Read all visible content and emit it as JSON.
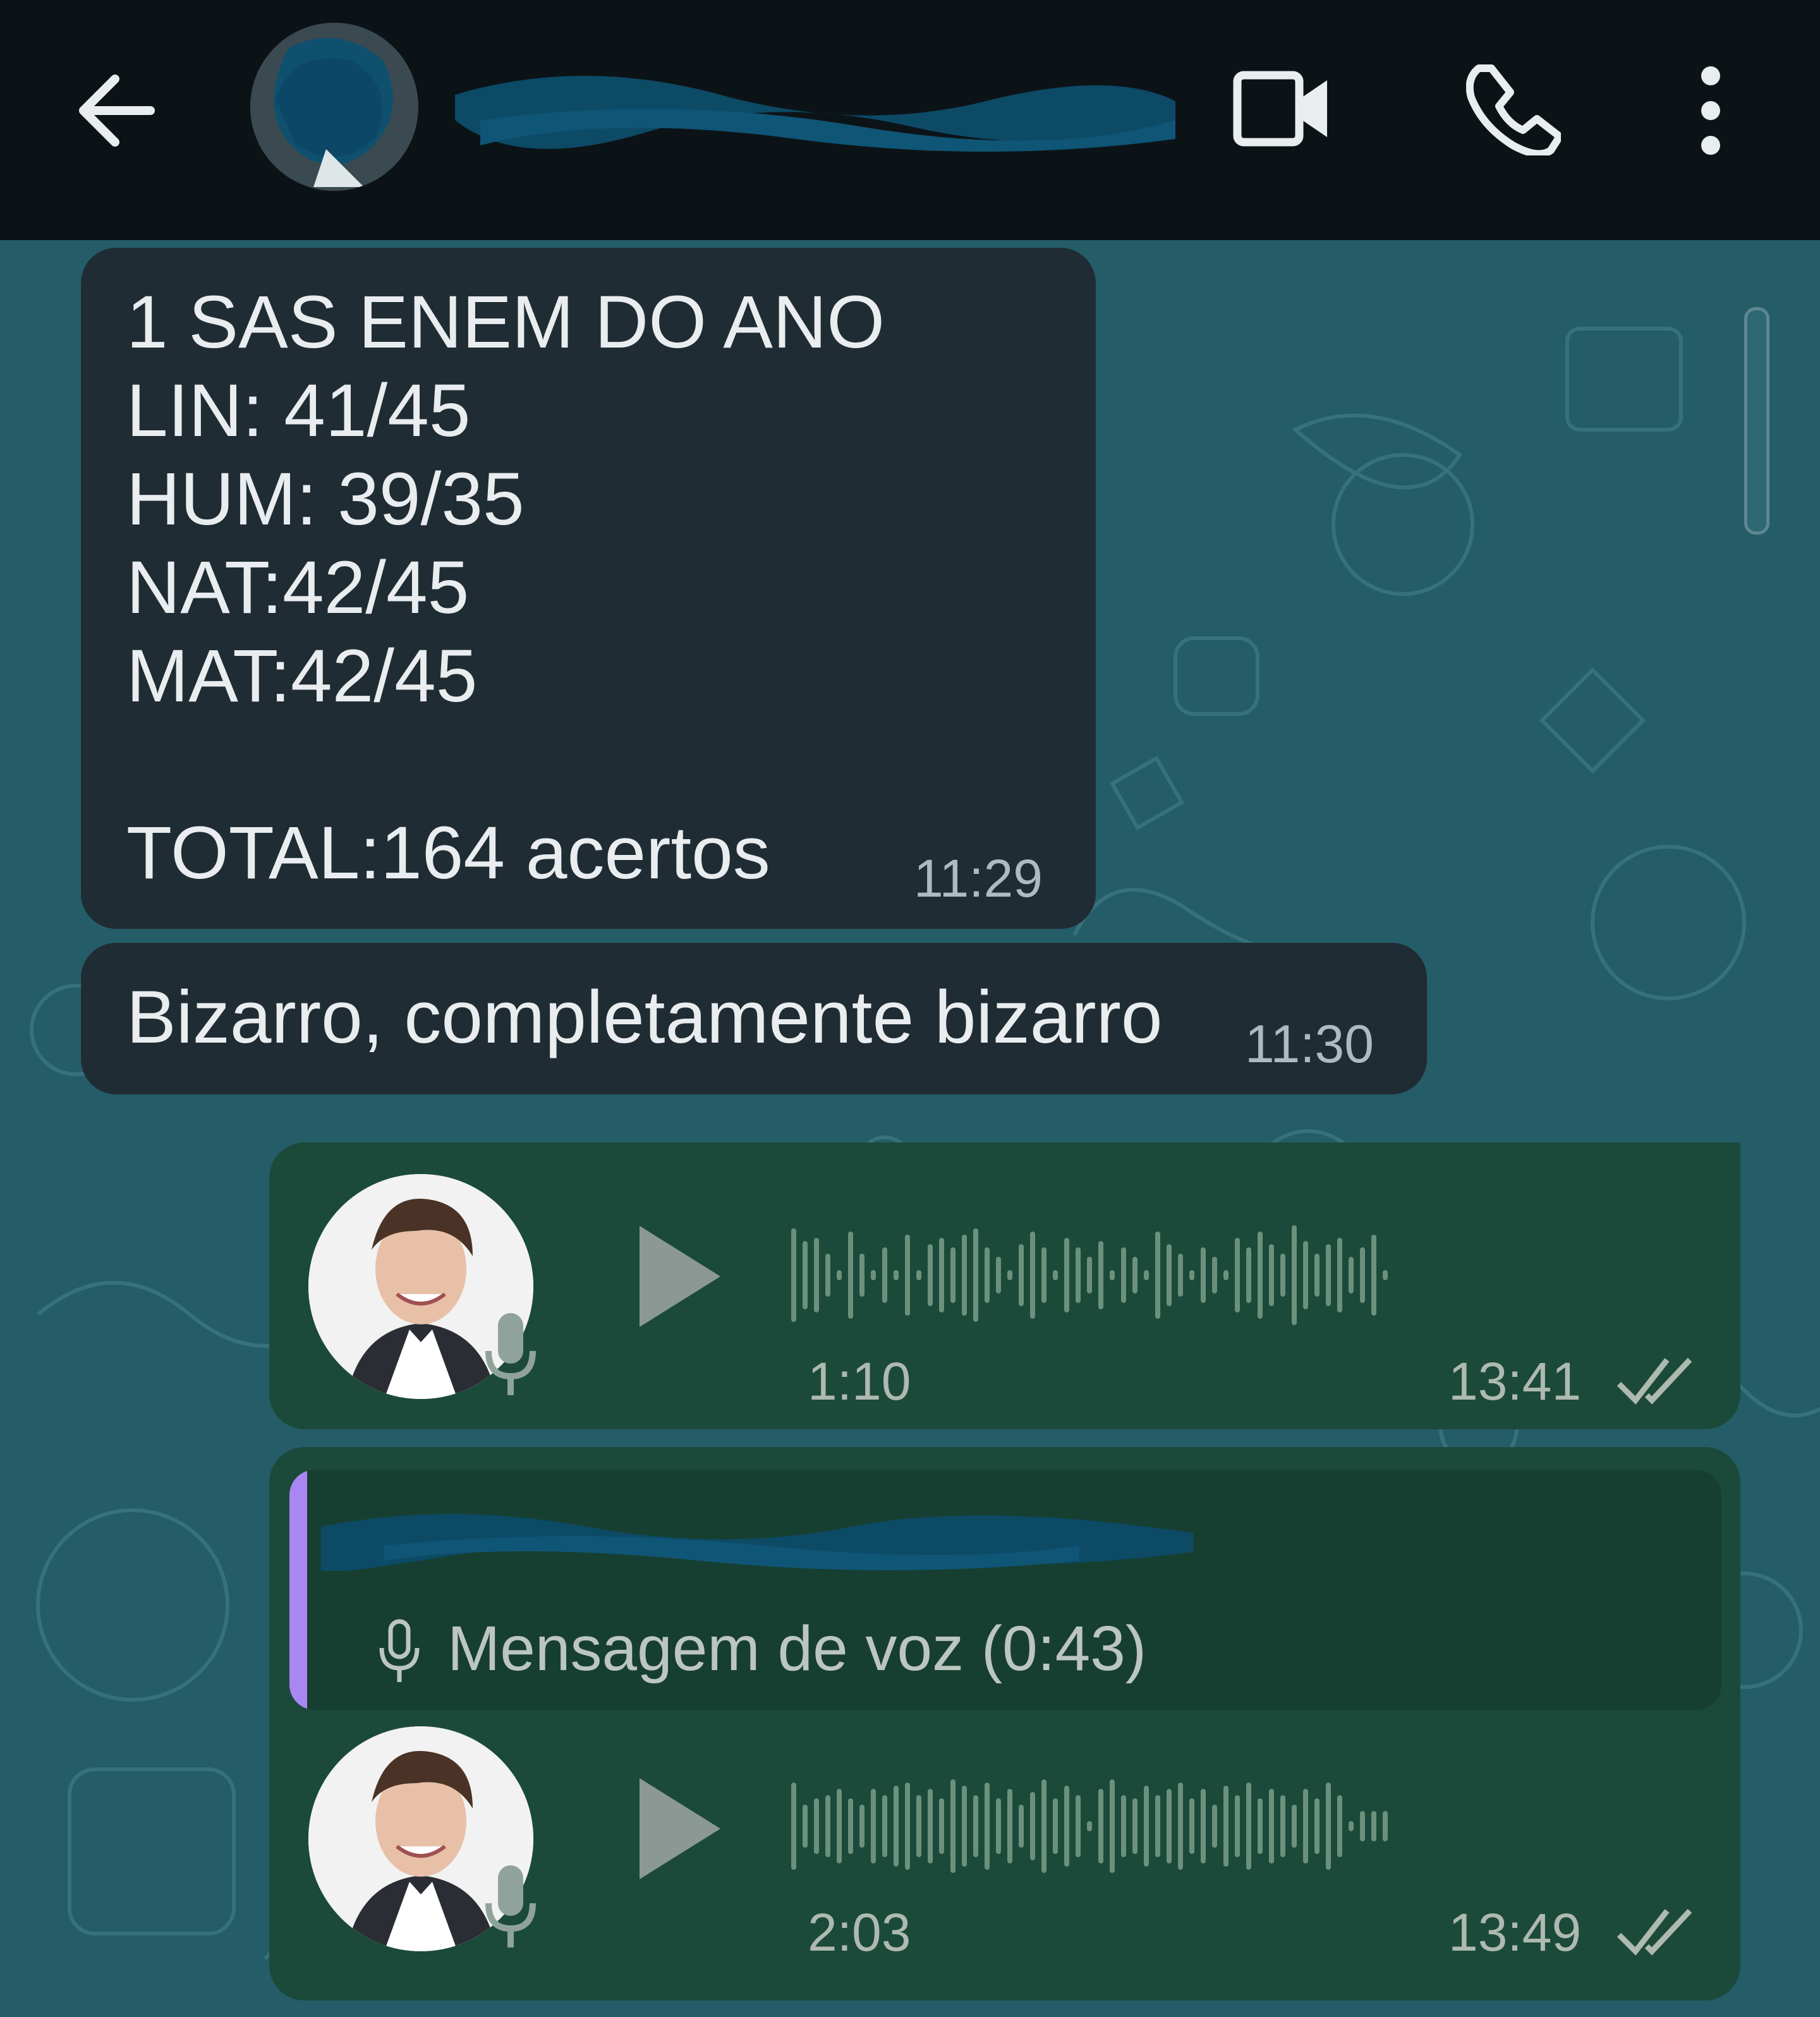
{
  "header": {
    "back_icon": "arrow-left-icon",
    "video_call_icon": "video-camera-icon",
    "voice_call_icon": "phone-icon",
    "menu_icon": "more-vertical-icon"
  },
  "messages": [
    {
      "type": "text",
      "direction": "incoming",
      "text": "1 SAS ENEM DO ANO\nLIN: 41/45\nHUM: 39/35\nNAT:42/45\nMAT:42/45\n\nTOTAL:164 acertos",
      "time": "11:29"
    },
    {
      "type": "text",
      "direction": "incoming",
      "text": "Bizarro, completamente bizarro",
      "time": "11:30"
    },
    {
      "type": "voice",
      "direction": "outgoing",
      "duration": "1:10",
      "time": "13:41",
      "status_icon": "double-check-icon",
      "progress": 0
    },
    {
      "type": "voice",
      "direction": "outgoing",
      "quoted": {
        "icon": "microphone-icon",
        "text": "Mensagem de voz (0:43)"
      },
      "duration": "2:03",
      "time": "13:49",
      "status_icon": "double-check-icon",
      "progress": 0
    }
  ],
  "colors": {
    "topbar": "#0c1317",
    "chat_background": "#245d68",
    "incoming_bubble": "#1f2c33",
    "outgoing_bubble": "#1b4a3a",
    "quote_accent": "#a987f3",
    "mic_badge": "#8fa39a"
  }
}
